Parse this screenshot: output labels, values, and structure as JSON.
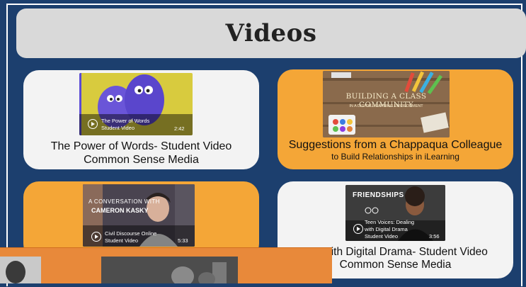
{
  "page": {
    "title": "Videos"
  },
  "cards": [
    {
      "caption_line1": "The Power of Words- Student Video",
      "caption_line2": "Common Sense Media",
      "video_title": "The Power of Words",
      "video_subtitle": "Student Video",
      "duration": "2:42"
    },
    {
      "caption_line1": "Suggestions from a Chappaqua Colleague",
      "caption_line2": "to Build Relationships in iLearning",
      "thumb_title": "BUILDING A CLASS COMMUNITY",
      "thumb_subtitle": "IN A DIGITAL LEARNING ENVIRONMENT"
    },
    {
      "thumb_line1": "A CONVERSATION WITH",
      "thumb_line2": "CAMERON KASKY",
      "video_title": "Civil Discourse Online",
      "video_subtitle": "Student Video",
      "duration": "5:33"
    },
    {
      "caption_line1": "D... with Digital Drama- Student Video",
      "caption_line2": "Common Sense Media",
      "thumb_word": "FRIENDSHIPS",
      "video_title": "Teen Voices: Dealing with Digital Drama",
      "video_subtitle": "Student Video",
      "duration": "3:56"
    }
  ]
}
